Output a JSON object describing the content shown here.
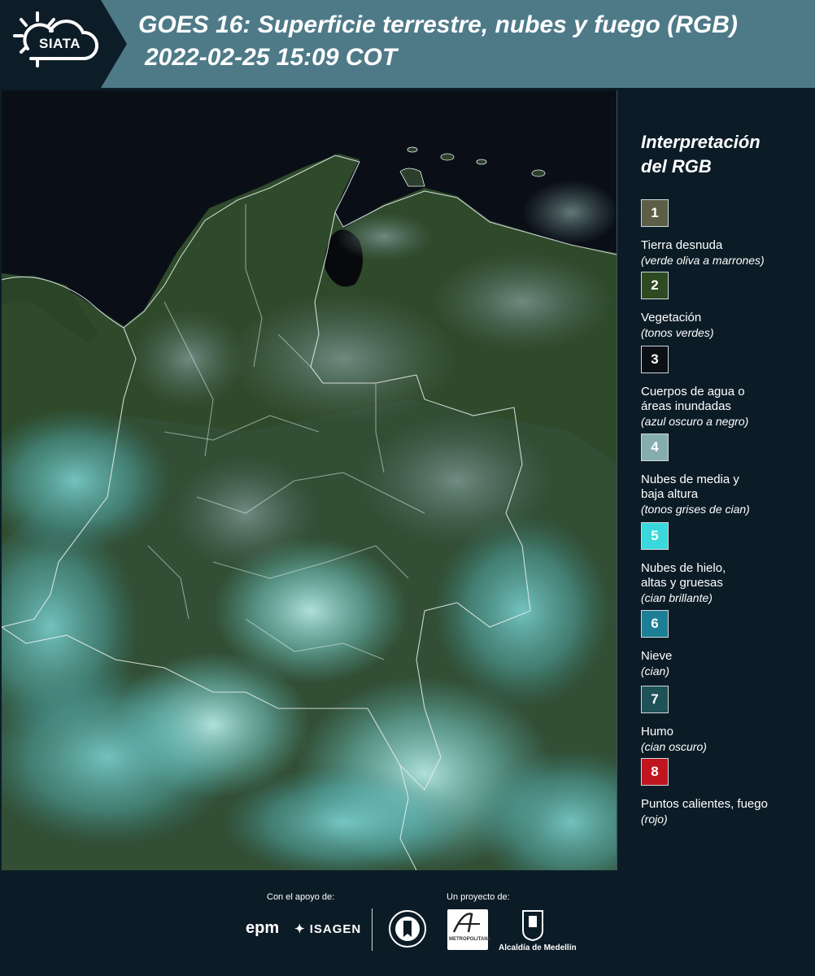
{
  "header": {
    "logo_text": "SIATA",
    "title_line1": "GOES 16: Superficie terrestre, nubes y fuego (RGB)",
    "title_line2": "2022-02-25 15:09 COT",
    "colors": {
      "header_bg": "#4e7a88",
      "logo_bg": "#0d1d28"
    }
  },
  "legend": {
    "title_line1": "Interpretación",
    "title_line2": "del RGB",
    "items": [
      {
        "number": "1",
        "label": "Tierra desnuda",
        "desc": "(verde oliva a marrones)",
        "color": "#5c5e45"
      },
      {
        "number": "2",
        "label": "Vegetación",
        "desc": "(tonos verdes)",
        "color": "#2e4a22"
      },
      {
        "number": "3",
        "label_line1": "Cuerpos de agua o",
        "label_line2": "áreas inundadas",
        "desc": "(azul oscuro a negro)",
        "color": "#0c0f14"
      },
      {
        "number": "4",
        "label_line1": "Nubes de media y",
        "label_line2": "baja altura",
        "desc": "(tonos grises de cian)",
        "color": "#86aeb0"
      },
      {
        "number": "5",
        "label_line1": "Nubes de hielo,",
        "label_line2": "altas y gruesas",
        "desc": "(cian brillante)",
        "color": "#3ad8dc"
      },
      {
        "number": "6",
        "label": "Nieve",
        "desc": "(cian)",
        "color": "#1d7f95"
      },
      {
        "number": "7",
        "label": "Humo",
        "desc": "(cian oscuro)",
        "color": "#1e5257"
      },
      {
        "number": "8",
        "label": "Puntos calientes, fuego",
        "desc": "(rojo)",
        "color": "#c0151f"
      }
    ]
  },
  "footer": {
    "support_caption": "Con el apoyo de:",
    "project_caption": "Un proyecto de:",
    "sponsors": [
      "epm",
      "ISAGEN"
    ],
    "partners": [
      "Área Metropolitana Valle de Aburrá",
      "Alcaldía de Medellín"
    ],
    "area_logo_text": "METROPOLITANA",
    "alcaldia_text": "Alcaldía de Medellín"
  }
}
